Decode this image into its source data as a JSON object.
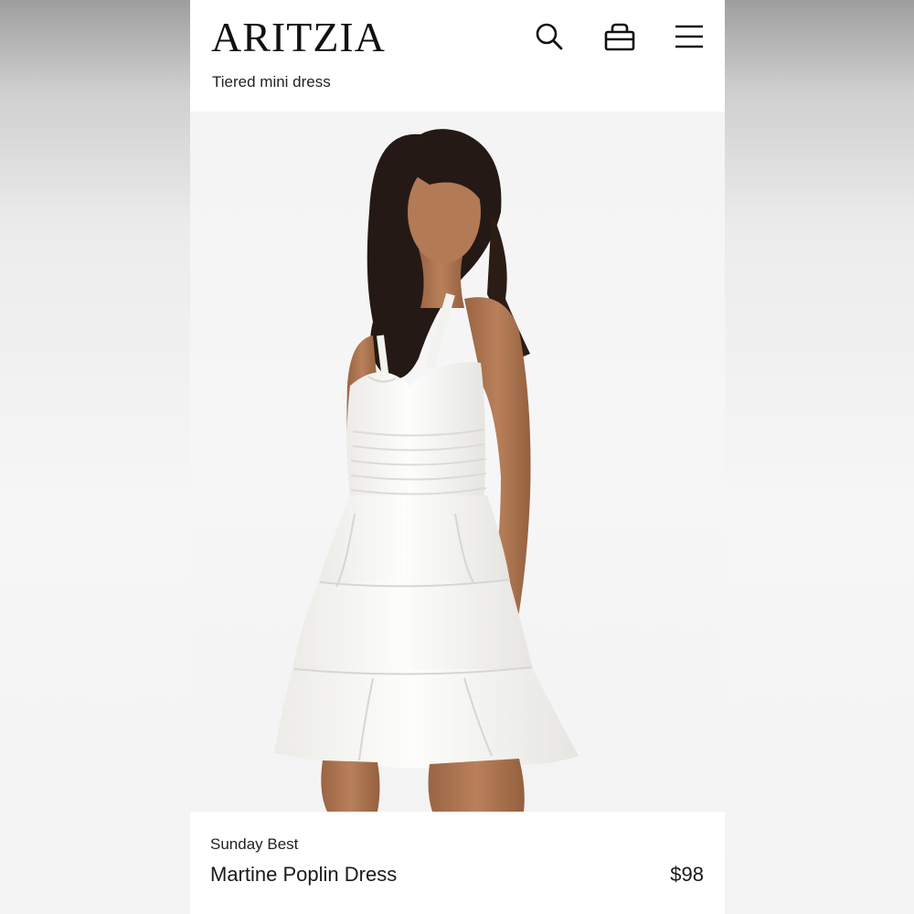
{
  "header": {
    "logo": "ARITZIA",
    "subtitle": "Tiered mini dress",
    "icons": [
      "search-icon",
      "bag-icon",
      "menu-icon"
    ]
  },
  "hero": {
    "image_subject": "model-wearing-white-tiered-mini-dress"
  },
  "product": {
    "brand": "Sunday Best",
    "name": "Martine Poplin Dress",
    "price": "$98"
  },
  "colors": {
    "text": "#111111",
    "background": "#ffffff",
    "hero_bg": "#f4f4f4",
    "dress": "#fbfbf9",
    "skin": "#b47a55",
    "hair": "#241914"
  }
}
